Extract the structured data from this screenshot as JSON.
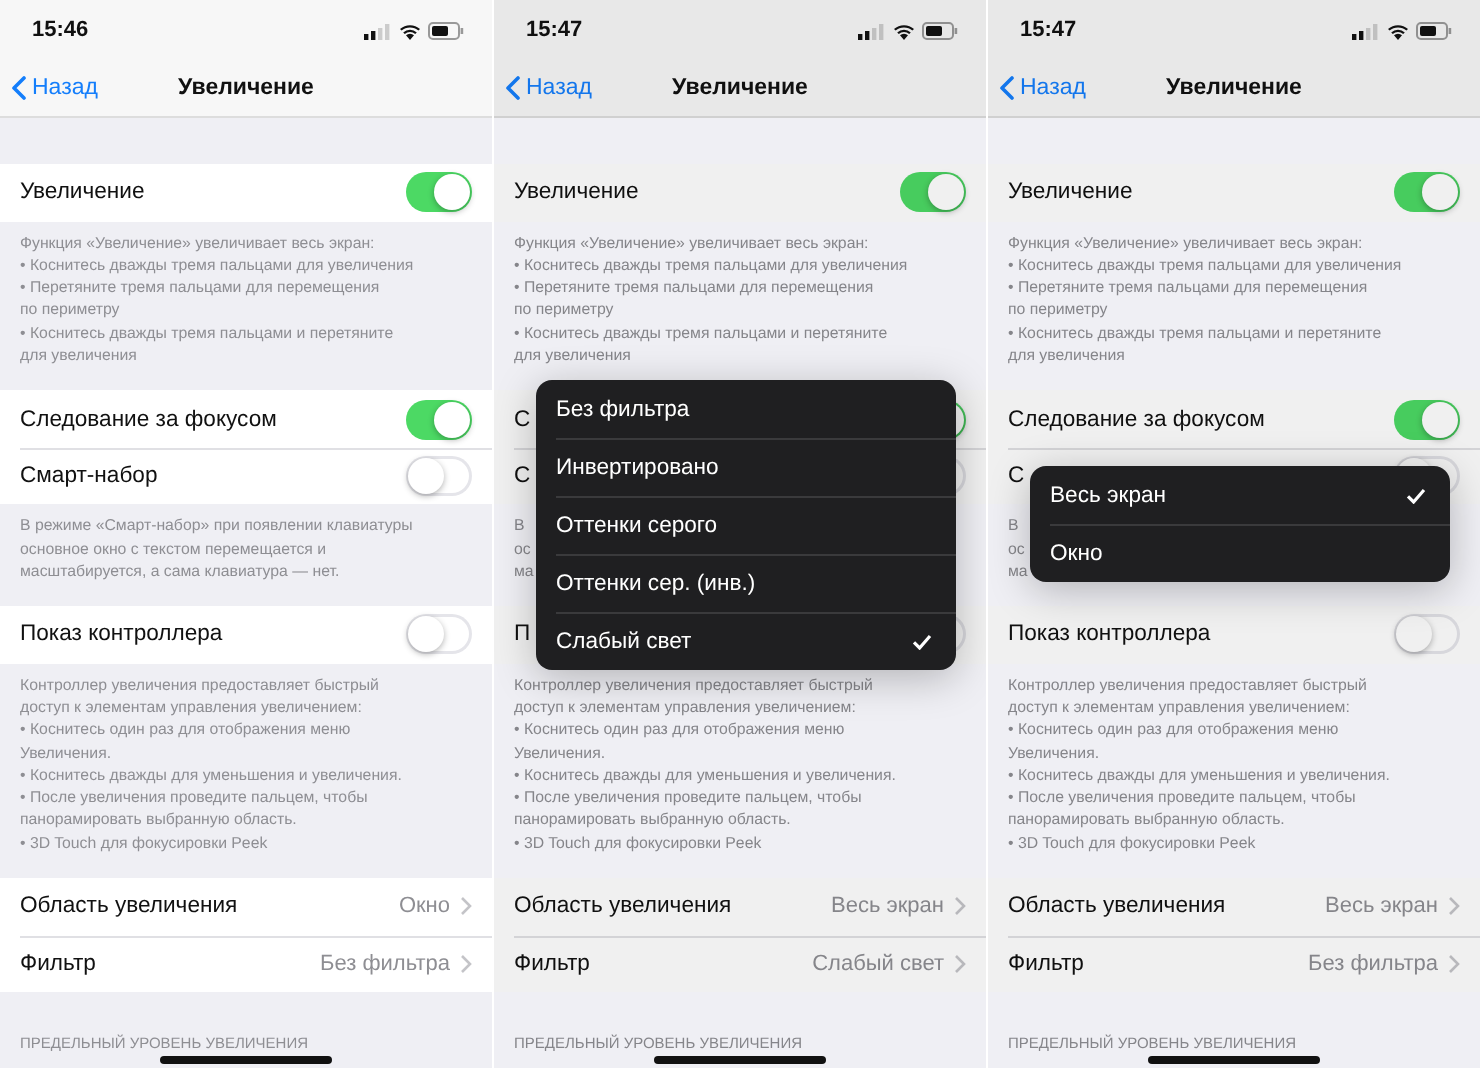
{
  "phones": [
    {
      "time": "15:46",
      "back": "Назад",
      "title": "Увеличение",
      "dimmed": false,
      "groups": [
        {
          "rows": [
            {
              "kind": "toggle",
              "label": "Увеличение",
              "on": true
            }
          ],
          "note": [
            "Функция «Увеличение» увеличивает весь экран:",
            "• Коснитесь дважды тремя пальцами для увеличения",
            "• Перетяните тремя пальцами для перемещения",
            "по периметру",
            "• Коснитесь дважды тремя пальцами и перетяните",
            "для увеличения"
          ]
        },
        {
          "rows": [
            {
              "kind": "toggle",
              "label": "Следование за фокусом",
              "on": true
            },
            {
              "kind": "toggle",
              "label": "Смарт-набор",
              "on": false
            }
          ],
          "note": [
            "В режиме «Смарт-набор» при появлении клавиатуры",
            "основное окно с текстом перемещается и",
            "масштабируется, а сама клавиатура — нет."
          ]
        },
        {
          "rows": [
            {
              "kind": "toggle",
              "label": "Показ контроллера",
              "on": false
            }
          ],
          "note": [
            "Контроллер увеличения предоставляет быстрый",
            "доступ к элементам управления увеличением:",
            "• Коснитесь один раз для отображения меню",
            "Увеличения.",
            "• Коснитесь дважды для уменьшения и увеличения.",
            "• После увеличения проведите пальцем, чтобы",
            "панорамировать выбранную область.",
            "• 3D Touch для фокусировки Peek"
          ]
        },
        {
          "rows": [
            {
              "kind": "link",
              "label": "Область увеличения",
              "value": "Окно"
            },
            {
              "kind": "link",
              "label": "Фильтр",
              "value": "Без фильтра"
            }
          ]
        }
      ],
      "section_header": "ПРЕДЕЛЬНЫЙ УРОВЕНЬ УВЕЛИЧЕНИЯ"
    },
    {
      "time": "15:47",
      "back": "Назад",
      "title": "Увеличение",
      "dimmed": true,
      "groups": [
        {
          "rows": [
            {
              "kind": "toggle",
              "label": "Увеличение",
              "on": true
            }
          ],
          "note": [
            "Функция «Увеличение» увеличивает весь экран:",
            "• Коснитесь дважды тремя пальцами для увеличения",
            "• Перетяните тремя пальцами для перемещения",
            "по периметру",
            "• Коснитесь дважды тремя пальцами и перетяните",
            "для увеличения"
          ]
        },
        {
          "rows": [
            {
              "kind": "toggle",
              "label": "С",
              "on": true
            },
            {
              "kind": "toggle",
              "label": "С",
              "on": false
            }
          ],
          "note": [
            "В",
            "ос",
            "ма"
          ]
        },
        {
          "rows": [
            {
              "kind": "toggle",
              "label": "П",
              "on": false
            }
          ],
          "note": [
            "Контроллер увеличения предоставляет быстрый",
            "доступ к элементам управления увеличением:",
            "• Коснитесь один раз для отображения меню",
            "Увеличения.",
            "• Коснитесь дважды для уменьшения и увеличения.",
            "• После увеличения проведите пальцем, чтобы",
            "панорамировать выбранную область.",
            "• 3D Touch для фокусировки Peek"
          ]
        },
        {
          "rows": [
            {
              "kind": "link",
              "label": "Область увеличения",
              "value": "Весь экран"
            },
            {
              "kind": "link",
              "label": "Фильтр",
              "value": "Слабый свет"
            }
          ]
        }
      ],
      "section_header": "ПРЕДЕЛЬНЫЙ УРОВЕНЬ УВЕЛИЧЕНИЯ",
      "menu": {
        "kind": "filter",
        "items": [
          {
            "label": "Без фильтра",
            "selected": false
          },
          {
            "label": "Инвертировано",
            "selected": false
          },
          {
            "label": "Оттенки серого",
            "selected": false
          },
          {
            "label": "Оттенки сер. (инв.)",
            "selected": false
          },
          {
            "label": "Слабый свет",
            "selected": true
          }
        ]
      }
    },
    {
      "time": "15:47",
      "back": "Назад",
      "title": "Увеличение",
      "dimmed": true,
      "groups": [
        {
          "rows": [
            {
              "kind": "toggle",
              "label": "Увеличение",
              "on": true
            }
          ],
          "note": [
            "Функция «Увеличение» увеличивает весь экран:",
            "• Коснитесь дважды тремя пальцами для увеличения",
            "• Перетяните тремя пальцами для перемещения",
            "по периметру",
            "• Коснитесь дважды тремя пальцами и перетяните",
            "для увеличения"
          ]
        },
        {
          "rows": [
            {
              "kind": "toggle",
              "label": "Следование за фокусом",
              "on": true
            },
            {
              "kind": "toggle",
              "label": "С",
              "on": false
            }
          ],
          "note": [
            "В",
            "ос",
            "ма"
          ]
        },
        {
          "rows": [
            {
              "kind": "toggle",
              "label": "Показ контроллера",
              "on": false
            }
          ],
          "note": [
            "Контроллер увеличения предоставляет быстрый",
            "доступ к элементам управления увеличением:",
            "• Коснитесь один раз для отображения меню",
            "Увеличения.",
            "• Коснитесь дважды для уменьшения и увеличения.",
            "• После увеличения проведите пальцем, чтобы",
            "панорамировать выбранную область.",
            "• 3D Touch для фокусировки Peek"
          ]
        },
        {
          "rows": [
            {
              "kind": "link",
              "label": "Область увеличения",
              "value": "Весь экран"
            },
            {
              "kind": "link",
              "label": "Фильтр",
              "value": "Без фильтра"
            }
          ]
        }
      ],
      "section_header": "ПРЕДЕЛЬНЫЙ УРОВЕНЬ УВЕЛИЧЕНИЯ",
      "menu": {
        "kind": "region",
        "items": [
          {
            "label": "Весь экран",
            "selected": true
          },
          {
            "label": "Окно",
            "selected": false
          }
        ]
      }
    }
  ]
}
